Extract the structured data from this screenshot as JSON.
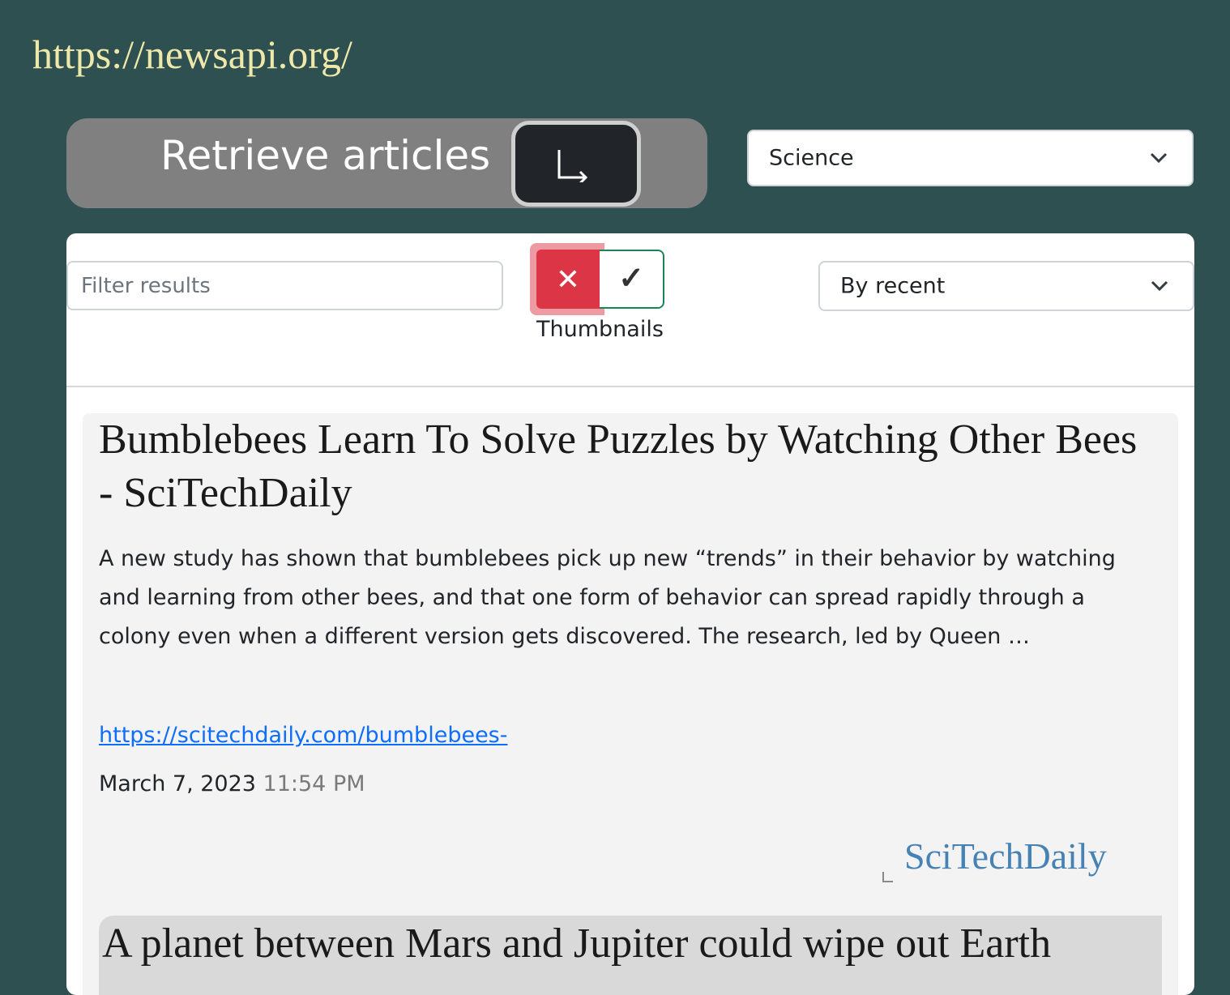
{
  "header": {
    "api_url": "https://newsapi.org/"
  },
  "controls": {
    "retrieve_label": "Retrieve articles",
    "retrieve_icon": "return-arrow-icon",
    "category_selected": "Science",
    "filter_placeholder": "Filter results",
    "filter_value": "",
    "thumbnails_toggle": {
      "off_symbol": "✕",
      "on_symbol": "✓",
      "caption": "Thumbnails",
      "state": "off"
    },
    "sort_selected": "By recent"
  },
  "articles": [
    {
      "title": "Bumblebees Learn To Solve Puzzles by Watching Other Bees - SciTechDaily",
      "description": "A new study has shown that bumblebees pick up new “trends” in their behavior by watching and learning from other bees, and that one form of behavior can spread rapidly through a colony even when a different version gets discovered. The research, led by Queen …",
      "url": "https://scitechdaily.com/bumblebees-",
      "date": "March 7, 2023",
      "time": "11:54 PM",
      "thumbnail_alt": "SciTechDaily"
    },
    {
      "title": "A planet between Mars and Jupiter could wipe out Earth"
    }
  ],
  "colors": {
    "background": "#2f5050",
    "url_text": "#eee8aa",
    "toggle_off": "#dc3545",
    "toggle_on_border": "#198754",
    "link": "#0d6efd",
    "thumb_alt": "#4682b4"
  }
}
